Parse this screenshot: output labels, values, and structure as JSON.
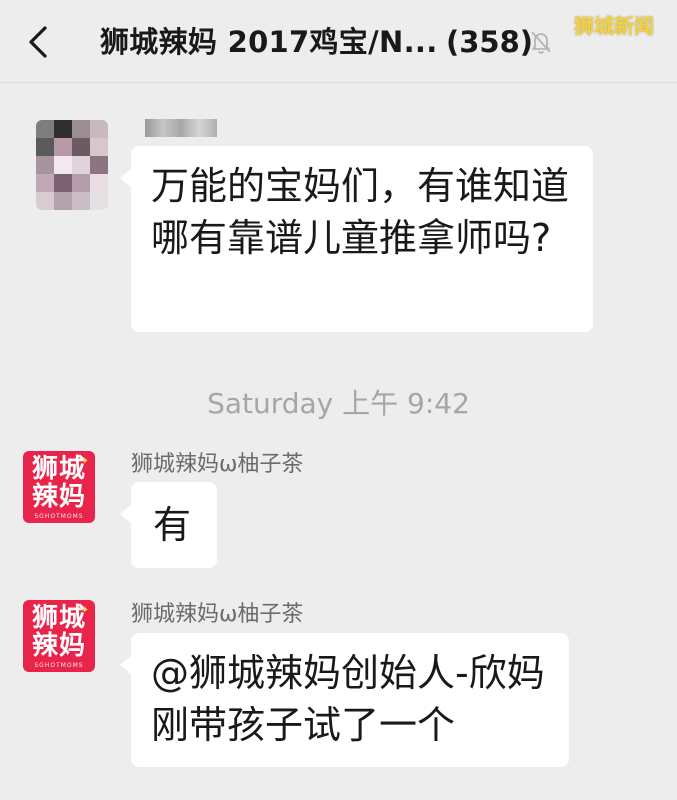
{
  "header": {
    "title": "狮城辣妈 2017鸡宝/N...",
    "member_count": "(358)",
    "back_icon": "chevron-left-icon",
    "mute_icon": "bell-off-icon"
  },
  "watermark": "狮城新闻",
  "messages": [
    {
      "sender": "",
      "avatar": "blurred-photo",
      "text": "万能的宝妈们，有谁知道哪有靠谱儿童推拿师吗?"
    },
    {
      "sender": "狮城辣妈ω柚子茶",
      "avatar": "logo",
      "text": "有"
    },
    {
      "sender": "狮城辣妈ω柚子茶",
      "avatar": "logo",
      "text": "@狮城辣妈创始人-欣妈 刚带孩子试了一个"
    }
  ],
  "timestamp": "Saturday 上午 9:42",
  "logo": {
    "line1": "狮城",
    "line2": "辣妈",
    "sub": "SGHOTMOMS",
    "color": "#e8244a"
  }
}
